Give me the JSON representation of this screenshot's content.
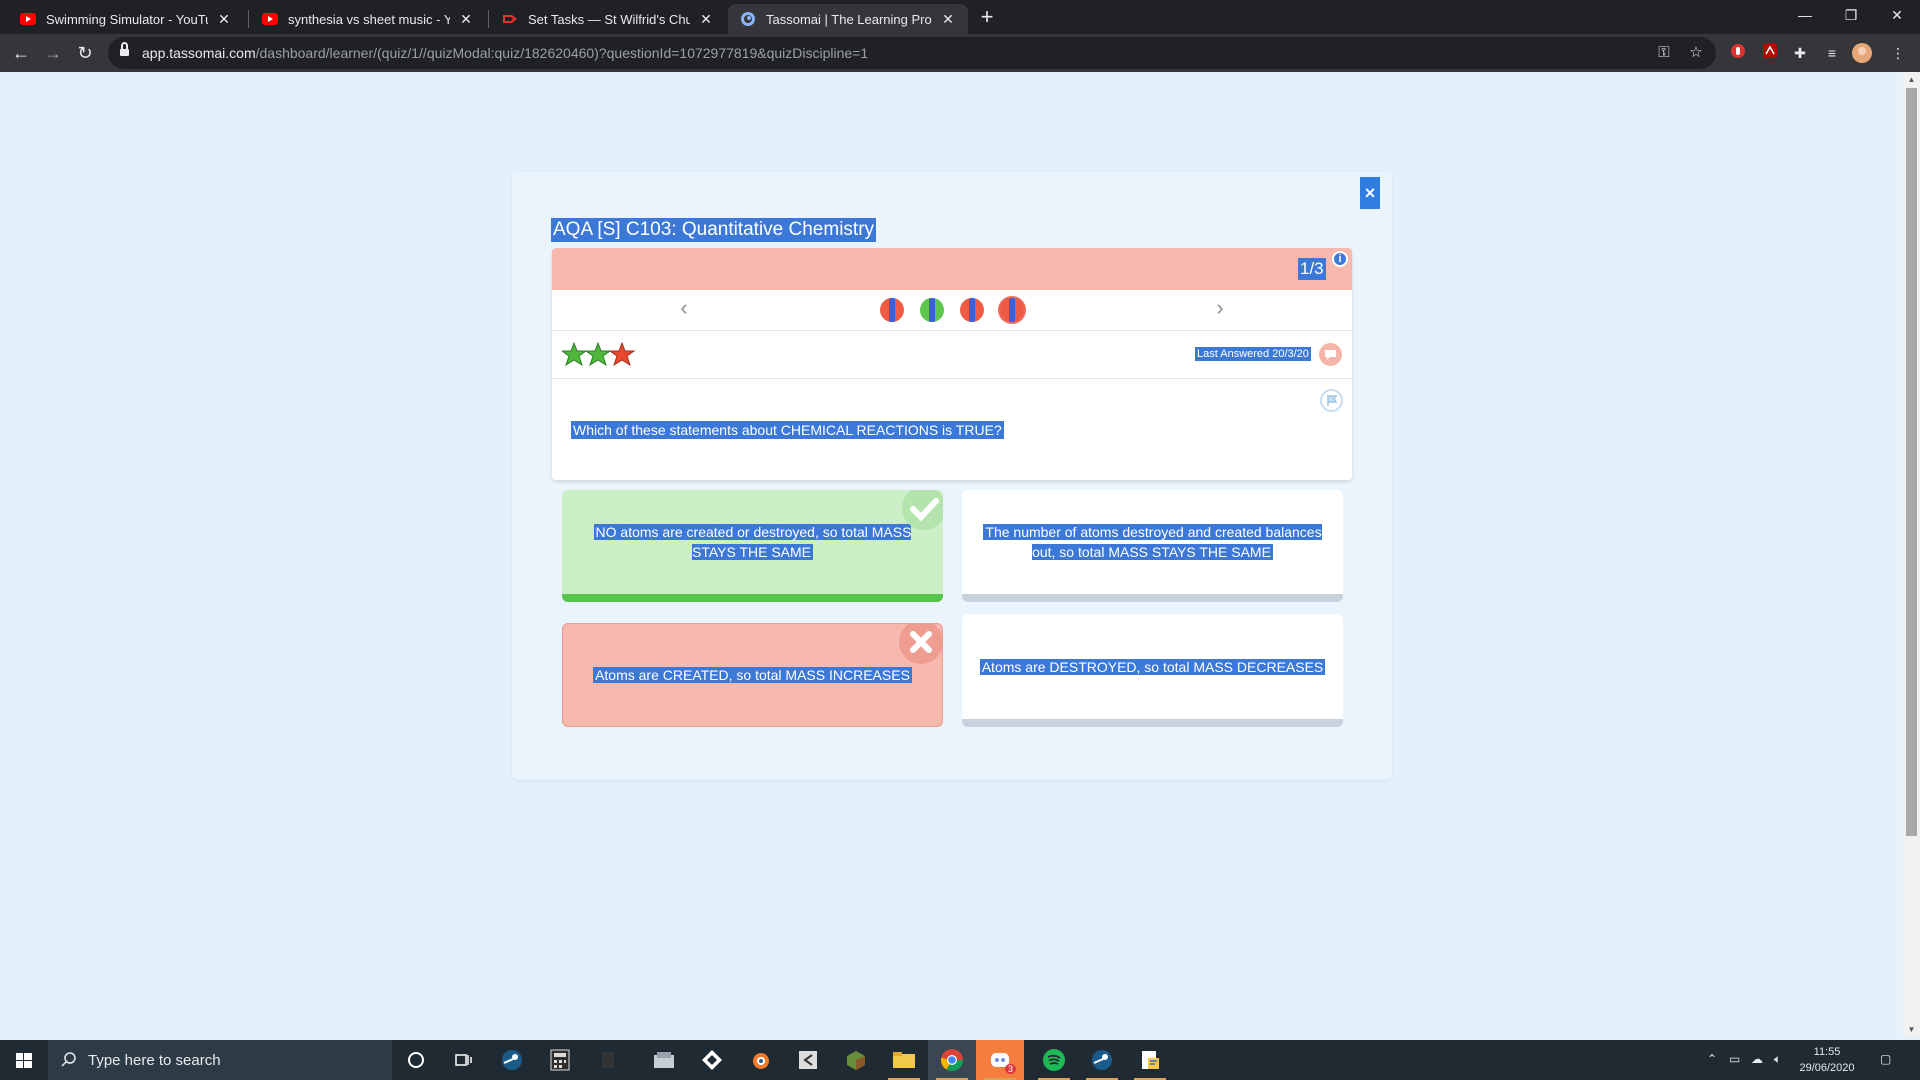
{
  "browser": {
    "tabs": [
      {
        "title": "Swimming Simulator - YouTube",
        "icon": "youtube-icon",
        "active": false
      },
      {
        "title": "synthesia vs sheet music - YouTu",
        "icon": "youtube-icon",
        "active": false
      },
      {
        "title": "Set Tasks — St Wilfrid's Church o",
        "icon": "task-icon",
        "active": false
      },
      {
        "title": "Tassomai | The Learning Program",
        "icon": "tassomai-icon",
        "active": true
      }
    ],
    "url_host": "app.tassomai.com",
    "url_path": "/dashboard/learner/(quiz/1//quizModal:quiz/182620460)?questionId=1072977819&quizDiscipline=1"
  },
  "quiz": {
    "title": "AQA [S] C103: Quantitative Chemistry",
    "close_label": "×",
    "counter": "1/3",
    "info_label": "i",
    "progress_dots": [
      "red",
      "green",
      "red",
      "red"
    ],
    "stars": [
      "green",
      "green",
      "red"
    ],
    "last_answered": "Last Answered 20/3/20",
    "question": "Which of these statements about CHEMICAL REACTIONS is TRUE?",
    "answers": [
      {
        "text": "NO atoms are created or destroyed, so total MASS STAYS THE SAME",
        "state": "correct"
      },
      {
        "text": "The number of atoms destroyed and created balances out, so total MASS STAYS THE SAME",
        "state": "neutral"
      },
      {
        "text": "Atoms are CREATED, so total MASS INCREASES",
        "state": "wrong"
      },
      {
        "text": "Atoms are DESTROYED, so total MASS DECREASES",
        "state": "neutral"
      }
    ]
  },
  "taskbar": {
    "search_placeholder": "Type here to search",
    "time": "11:55",
    "date": "29/06/2020",
    "discord_badge": "3"
  },
  "colors": {
    "accent_selection": "#3c78d8",
    "correct": "#cbeec6",
    "wrong": "#f7b8ad"
  }
}
